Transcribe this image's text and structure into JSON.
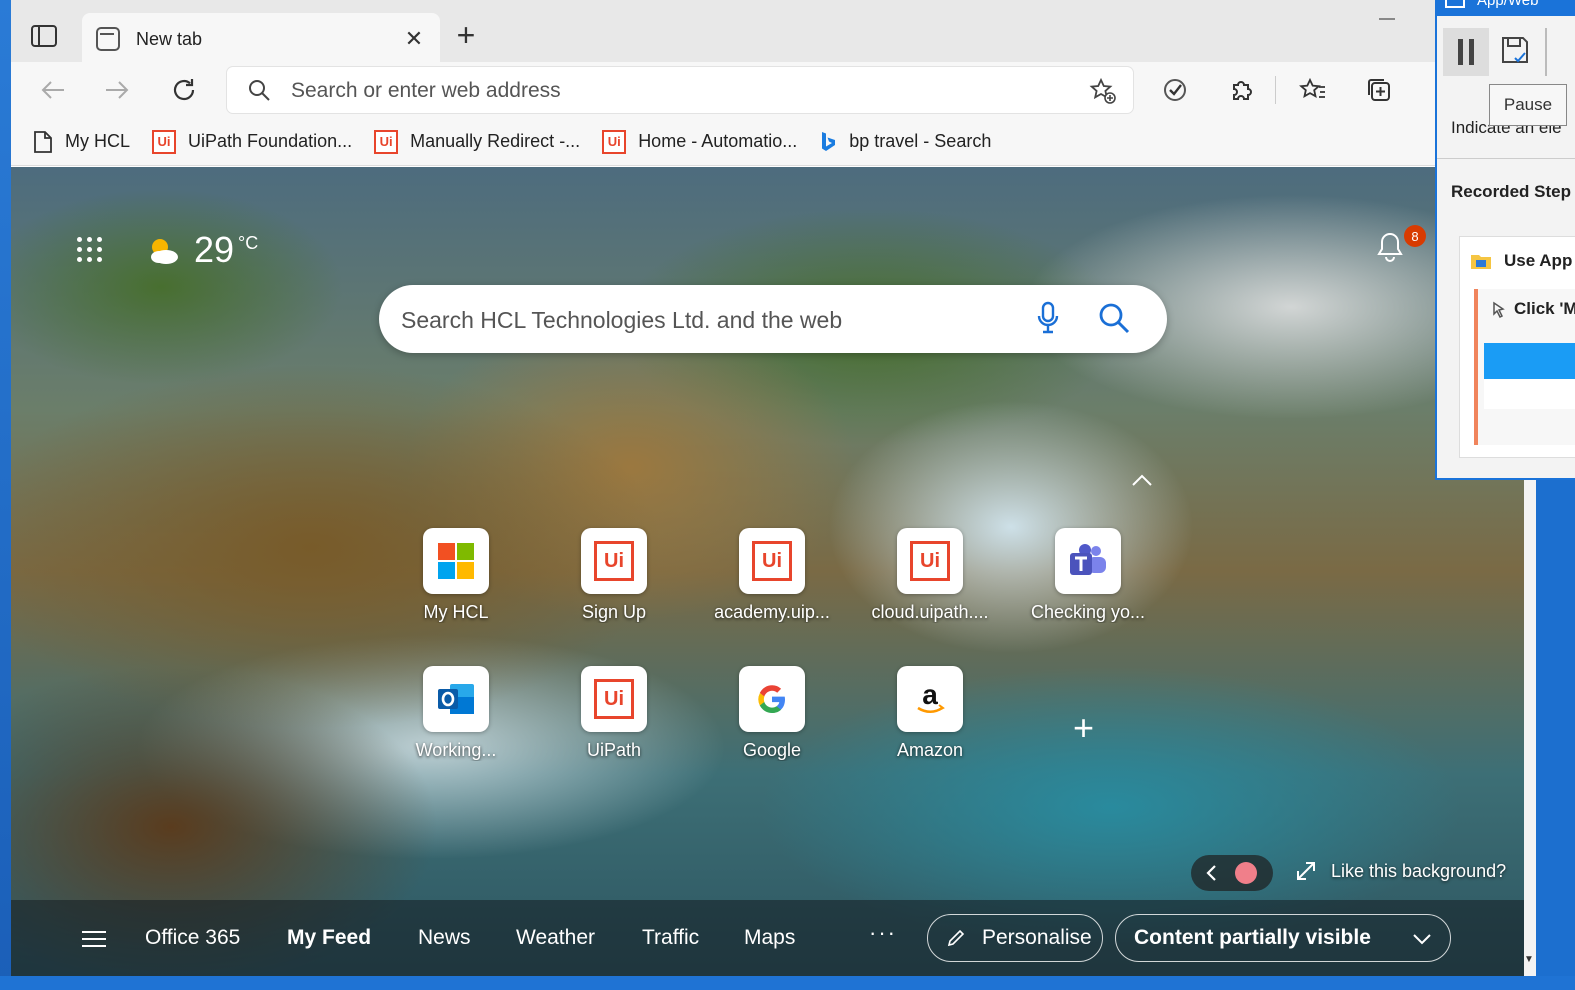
{
  "browser": {
    "tab_title": "New tab",
    "address_placeholder": "Search or enter web address"
  },
  "bookmarks": [
    {
      "label": "My HCL",
      "icon": "page-icon"
    },
    {
      "label": "UiPath Foundation...",
      "icon": "uipath-icon"
    },
    {
      "label": "Manually Redirect -...",
      "icon": "uipath-icon"
    },
    {
      "label": "Home - Automatio...",
      "icon": "uipath-icon"
    },
    {
      "label": "bp travel - Search",
      "icon": "bing-icon"
    }
  ],
  "newtab": {
    "temperature": "29",
    "temp_unit": "°C",
    "notification_count": "8",
    "search_placeholder": "Search HCL Technologies Ltd. and the web",
    "tiles": [
      {
        "label": "My HCL",
        "icon": "microsoft-icon"
      },
      {
        "label": "Sign Up",
        "icon": "uipath-icon"
      },
      {
        "label": "academy.uip...",
        "icon": "uipath-icon"
      },
      {
        "label": "cloud.uipath....",
        "icon": "uipath-icon"
      },
      {
        "label": "Checking yo...",
        "icon": "teams-icon"
      },
      {
        "label": "Working...",
        "icon": "outlook-icon"
      },
      {
        "label": "UiPath",
        "icon": "uipath-icon"
      },
      {
        "label": "Google",
        "icon": "google-icon"
      },
      {
        "label": "Amazon",
        "icon": "amazon-icon"
      }
    ],
    "like_background": "Like this background?",
    "feed": {
      "items": [
        "Office 365",
        "My Feed",
        "News",
        "Weather",
        "Traffic",
        "Maps"
      ],
      "more": "···",
      "personalise": "Personalise",
      "content_visibility": "Content partially visible"
    }
  },
  "recorder": {
    "title": "App/Web",
    "pause_tooltip": "Pause",
    "indicate_text": "Indicate an ele",
    "recorded_steps": "Recorded Step",
    "step_use_app": "Use App",
    "step_click": "Click 'M"
  },
  "colors": {
    "uipath": "#e8452c",
    "edge_accent": "#1a73d9",
    "badge": "#d83b01"
  }
}
